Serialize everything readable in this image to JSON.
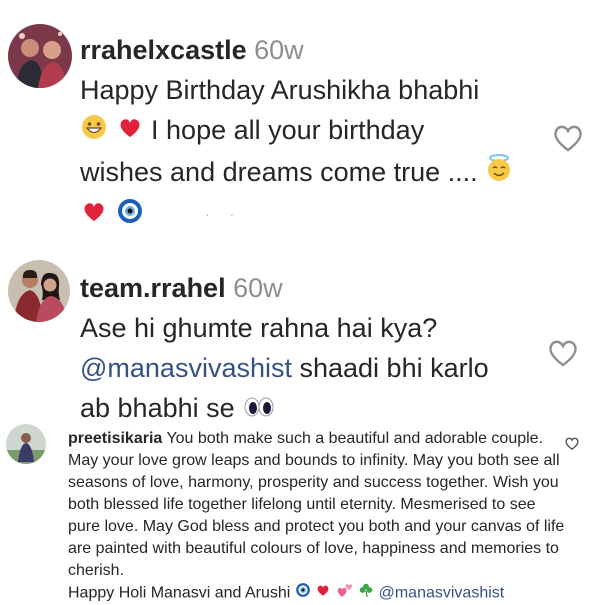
{
  "colors": {
    "text": "#262626",
    "muted": "#8e8e8e",
    "mention": "#385185",
    "heart": "#ed2d4a"
  },
  "comments": [
    {
      "username": "rrahelxcastle",
      "time": "60w",
      "lines": [
        "Happy Birthday Arushikha bhabhi",
        "I hope all your birthday",
        "wishes and dreams come true ...."
      ],
      "emojis": [
        "grinning-face",
        "red-heart",
        "smiling-face-with-halo",
        "red-heart",
        "nazar-amulet"
      ]
    },
    {
      "username": "team.rrahel",
      "time": "60w",
      "line1": "Ase hi ghumte rahna hai kya?",
      "mention": "@manasvivashist",
      "line2_rest": " shaadi bhi karlo",
      "line3": "ab bhabhi se",
      "emojis": [
        "eyes"
      ]
    },
    {
      "username": "preetisikaria",
      "text": " You both make such a beautiful and adorable couple. May your love grow leaps and bounds to infinity. May you both see all seasons of love, harmony, prosperity and success together. Wish you both blessed life together lifelong until eternity. Mesmerised to see pure love. May God bless and protect you both and your canvas of life are painted with beautiful colours of love, happiness and memories to cherish.",
      "last_line": "Happy Holi Manasvi and Arushi",
      "mention": "@manasvivashist",
      "emojis": [
        "nazar-amulet",
        "red-heart",
        "two-hearts",
        "shamrock"
      ]
    }
  ]
}
